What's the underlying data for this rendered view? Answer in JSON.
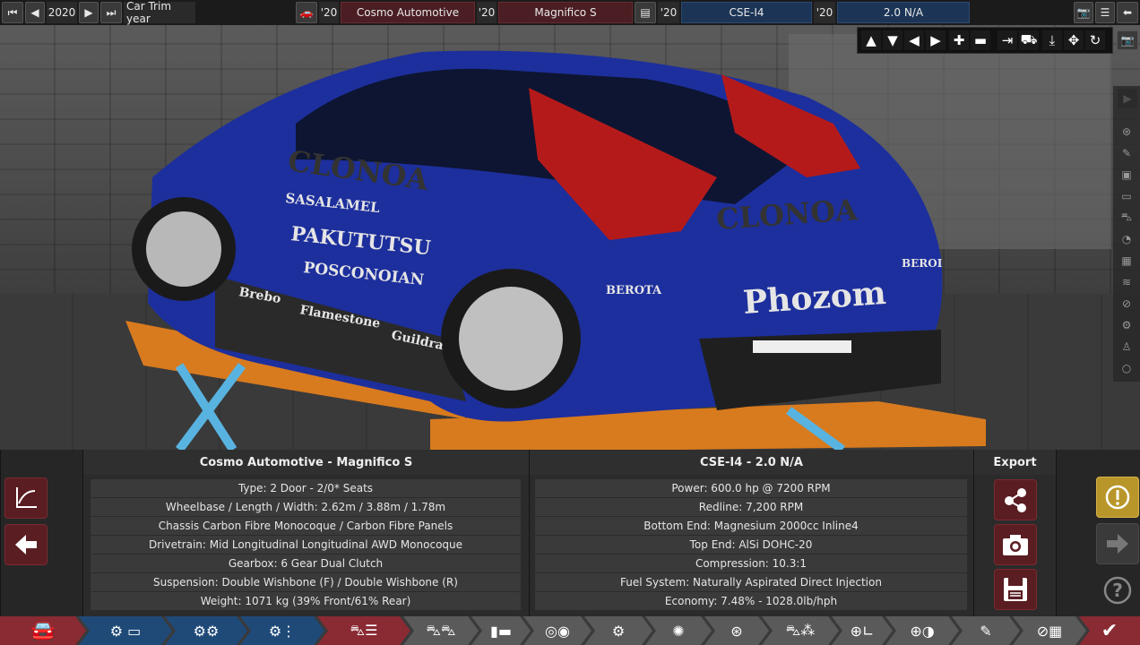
{
  "topbar": {
    "year": "2020",
    "trim_label": "Car Trim year",
    "model_year": "'20",
    "company": "Cosmo Automotive",
    "model_year2": "'20",
    "model": "Magnifico S",
    "engine_year": "'20",
    "engine_family": "CSE-I4",
    "engine_year2": "'20",
    "engine_variant": "2.0 N/A"
  },
  "car": {
    "decals": [
      "CLONOA",
      "SASALAMEL",
      "PAKUTUTSU",
      "POSCONOIAN",
      "Brebo",
      "Flamestone",
      "Guildra",
      "CLONOA",
      "BEROTA",
      "Phozom",
      "BEROI"
    ]
  },
  "car_info": {
    "header": "Cosmo Automotive - Magnifico S",
    "rows": [
      "Type: 2 Door - 2/0* Seats",
      "Wheelbase / Length / Width: 2.62m / 3.88m / 1.78m",
      "Chassis Carbon Fibre Monocoque / Carbon Fibre Panels",
      "Drivetrain: Mid Longitudinal Longitudinal AWD Monocoque",
      "Gearbox: 6 Gear Dual Clutch",
      "Suspension: Double Wishbone (F) / Double Wishbone (R)",
      "Weight: 1071 kg (39% Front/61% Rear)"
    ]
  },
  "engine_info": {
    "header": "CSE-I4 - 2.0 N/A",
    "rows": [
      "Power: 600.0 hp @ 7200 RPM",
      "Redline:  7,200 RPM",
      "Bottom End: Magnesium 2000cc Inline4",
      "Top End: AlSi DOHC-20",
      "Compression: 10.3:1",
      "Fuel System: Naturally Aspirated Direct Injection",
      "Economy: 7.48% - 1028.0lb/hph"
    ]
  },
  "export": {
    "header": "Export"
  },
  "colors": {
    "accent_red": "#5a1d22",
    "accent_blue": "#1c3556",
    "warn_gold": "#b8962a",
    "car_blue": "#1d2f9c"
  }
}
